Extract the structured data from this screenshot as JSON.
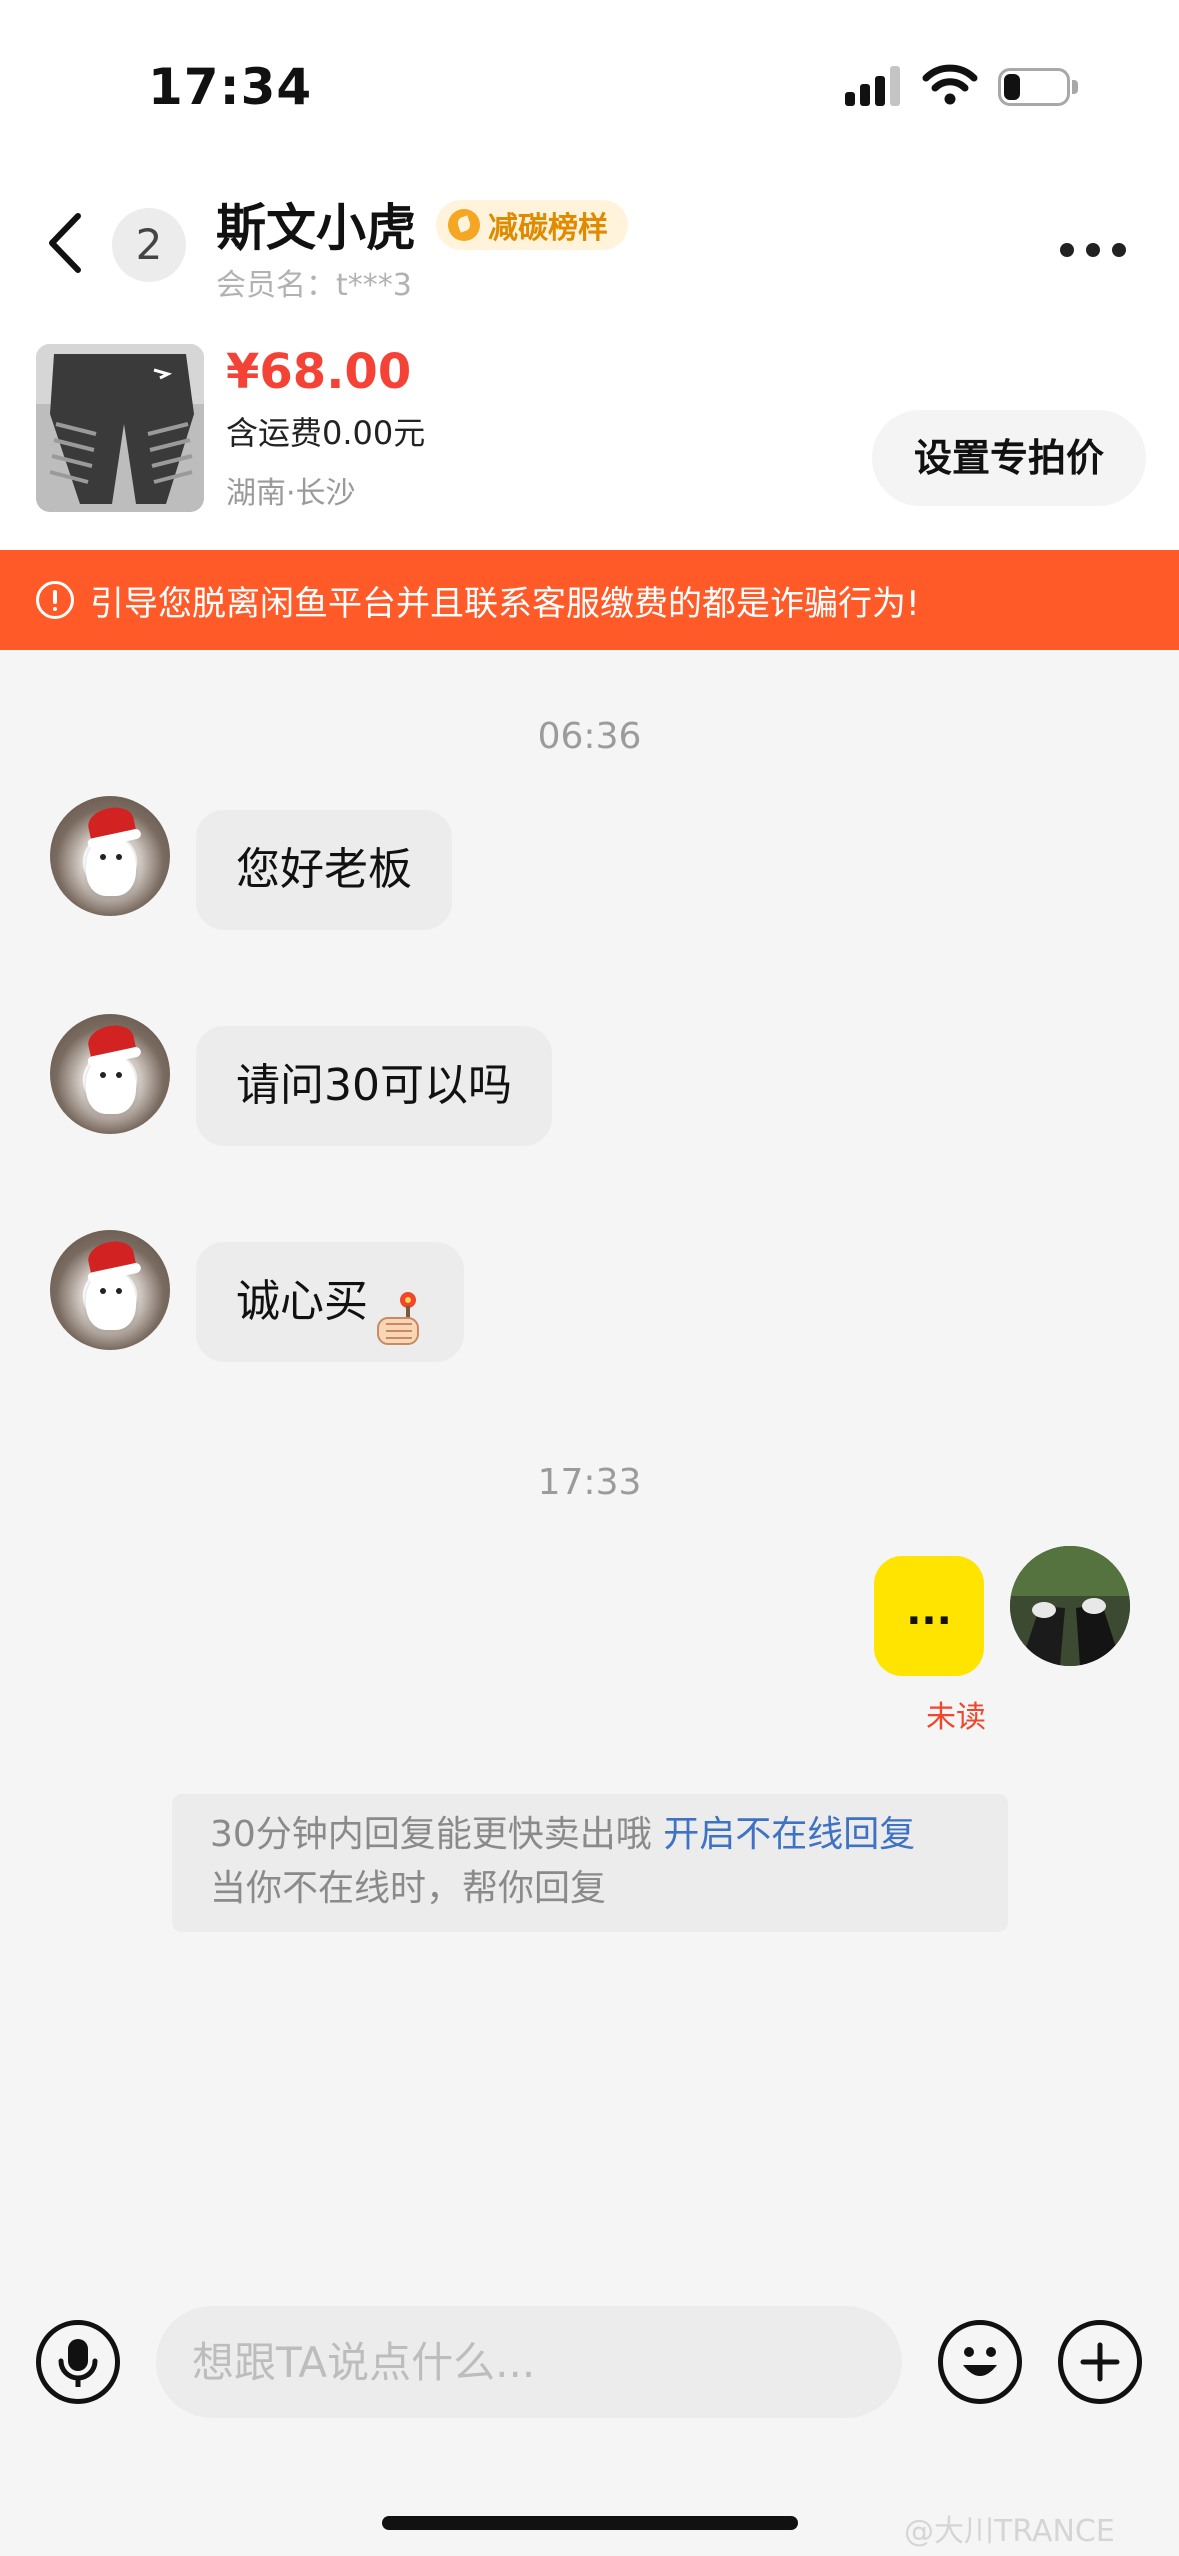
{
  "status_bar": {
    "time": "17:34"
  },
  "header": {
    "back_icon": "chevron-left-icon",
    "unread_count": "2",
    "contact_name": "斯文小虎",
    "badge_label": "减碳榜样",
    "member_name": "会员名：t***3",
    "more_icon": "more-horizontal-icon"
  },
  "product": {
    "price": "¥68.00",
    "shipping": "含运费0.00元",
    "location": "湖南·长沙",
    "special_price_button": "设置专拍价"
  },
  "warning": {
    "text": "引导您脱离闲鱼平台并且联系客服缴费的都是诈骗行为!",
    "background": "#ff5a28"
  },
  "chat": {
    "timestamp_1": "06:36",
    "messages_in": [
      {
        "text": "您好老板"
      },
      {
        "text": "请问30可以吗"
      },
      {
        "text": "诚心买"
      }
    ],
    "timestamp_2": "17:33",
    "message_out": {
      "text": "...",
      "status": "未读"
    },
    "tip": {
      "line1_text": "30分钟内回复能更快卖出哦",
      "line1_link": "开启不在线回复",
      "line2_text": "当你不在线时，帮你回复"
    }
  },
  "input_bar": {
    "voice_icon": "microphone-icon",
    "placeholder": "想跟TA说点什么...",
    "emoji_icon": "smiley-icon",
    "plus_icon": "plus-icon"
  },
  "watermark": "@大川TRANCE",
  "colors": {
    "price": "#f44336",
    "out_bubble": "#ffe400",
    "unread": "#f0462c",
    "link": "#3d72c4"
  }
}
